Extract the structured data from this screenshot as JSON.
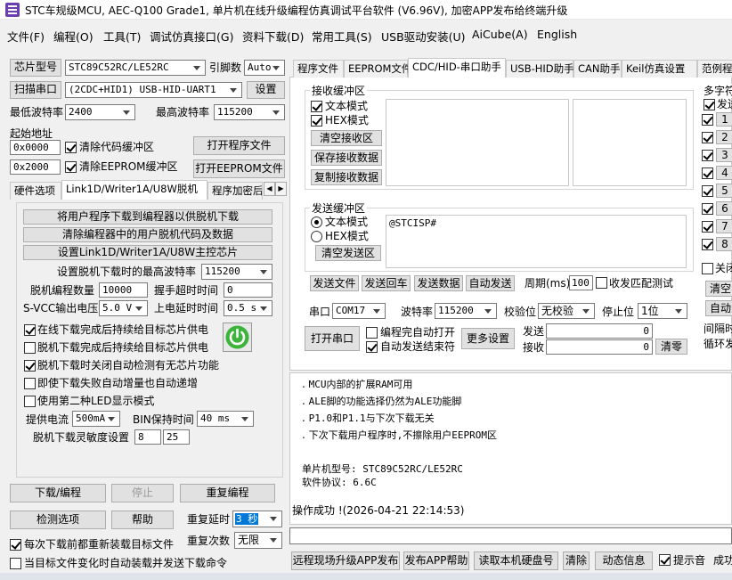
{
  "window": {
    "title": "STC车规级MCU, AEC-Q100 Grade1, 单片机在线升级编程仿真调试平台软件 (V6.96V), 加密APP发布给终端升级"
  },
  "menu": [
    "文件(F)",
    "编程(O)",
    "工具(T)",
    "调试仿真接口(G)",
    "资料下载(D)",
    "常用工具(S)",
    "USB驱动安装(U)",
    "AiCube(A)",
    "English"
  ],
  "left": {
    "chip_label": "芯片型号",
    "chip_value": "STC89C52RC/LE52RC",
    "pin_label": "引脚数",
    "pin_value": "Auto",
    "scan_label": "扫描串口",
    "port_value": "(2CDC+HID1) USB-HID-UART1",
    "settings_label": "设置",
    "min_baud_label": "最低波特率",
    "min_baud": "2400",
    "max_baud_label": "最高波特率",
    "max_baud": "115200",
    "start_addr_label": "起始地址",
    "addr1": "0x0000",
    "clear_code": "清除代码缓冲区",
    "open_prog": "打开程序文件",
    "addr2": "0x2000",
    "clear_eeprom": "清除EEPROM缓冲区",
    "open_eeprom": "打开EEPROM文件",
    "tabs": [
      "硬件选项",
      "Link1D/Writer1A/U8W脱机",
      "程序加密后"
    ],
    "offline": {
      "btn1": "将用户程序下载到编程器以供脱机下载",
      "btn2": "清除编程器中的用户脱机代码及数据",
      "btn3": "设置Link1D/Writer1A/U8W主控芯片",
      "max_baud_label": "设置脱机下载时的最高波特率",
      "max_baud": "115200",
      "count_label": "脱机编程数量",
      "count": "10000",
      "handshake_label": "握手超时时间",
      "handshake": "0",
      "svcc_label": "S-VCC输出电压",
      "svcc": "5.0 V",
      "delay_label": "上电延时时间",
      "delay": "0.5 s",
      "opt1": "在线下载完成后持续给目标芯片供电",
      "opt2": "脱机下载完成后持续给目标芯片供电",
      "opt3": "脱机下载时关闭自动检测有无芯片功能",
      "opt4": "即使下载失败自动增量也自动递增",
      "opt5": "使用第二种LED显示模式",
      "current_label": "提供电流",
      "current": "500mA",
      "bin_label": "BIN保持时间",
      "bin": "40 ms",
      "sens_label": "脱机下载灵敏度设置",
      "sens1": "8",
      "sens2": "25"
    },
    "download": "下载/编程",
    "stop": "停止",
    "reprog": "重复编程",
    "check": "检测选项",
    "help": "帮助",
    "delay_label": "重复延时",
    "delay_val": "3 秒",
    "times_label": "重复次数",
    "times_val": "无限",
    "reload": "每次下载前都重新装载目标文件",
    "auto_load": "当目标文件变化时自动装载并发送下载命令"
  },
  "right": {
    "tabs": [
      "程序文件",
      "EEPROM文件",
      "CDC/HID-串口助手",
      "USB-HID助手",
      "CAN助手",
      "Keil仿真设置",
      "范例程"
    ],
    "recv_group": "接收缓冲区",
    "text_mode": "文本模式",
    "hex_mode": "HEX模式",
    "clear_recv": "清空接收区",
    "save_recv": "保存接收数据",
    "copy_recv": "复制接收数据",
    "send_group": "发送缓冲区",
    "send_text_mode": "文本模式",
    "send_hex_mode": "HEX模式",
    "clear_send": "清空发送区",
    "send_content": "@STCISP#",
    "send_file": "发送文件",
    "send_enter": "发送回车",
    "send_data": "发送数据",
    "auto_send": "自动发送",
    "period_label": "周期(ms)",
    "period": "100",
    "match": "收发匹配测试",
    "port_label": "串口",
    "port": "COM17",
    "baud_label": "波特率",
    "baud": "115200",
    "parity_label": "校验位",
    "parity": "无校验",
    "stop_label": "停止位",
    "stop": "1位",
    "open_port": "打开串口",
    "close_after": "编程完自动打开",
    "auto_end": "自动发送结束符",
    "more": "更多设置",
    "send_count_label": "发送",
    "send_count": "0",
    "recv_count_label": "接收",
    "recv_count": "0",
    "clear_count": "清零",
    "multi_label": "多字符",
    "multi_send": "发送",
    "multi_rows": [
      "1",
      "2",
      "3",
      "4",
      "5",
      "6",
      "7",
      "8"
    ],
    "close_label": "关闭",
    "clear_label": "清空",
    "auto_label": "自动",
    "interval_label": "间隔时",
    "loop_label": "循环发",
    "log": [
      "MCU内部的扩展RAM可用",
      "ALE脚的功能选择仍然为ALE功能脚",
      "P1.0和P1.1与下次下载无关",
      "下次下载用户程序时,不擦除用户EEPROM区",
      "",
      "单片机型号: STC89C52RC/LE52RC",
      "软件协议: 6.6C",
      "",
      "",
      "操作成功 !(2026-04-21 22:14:53)"
    ],
    "btn_upgrade": "远程现场升级APP发布",
    "btn_publish_help": "发布APP帮助",
    "btn_read_disk": "读取本机硬盘号",
    "btn_clear": "清除",
    "btn_dynamic": "动态信息",
    "beep": "提示音",
    "success": "成功"
  }
}
